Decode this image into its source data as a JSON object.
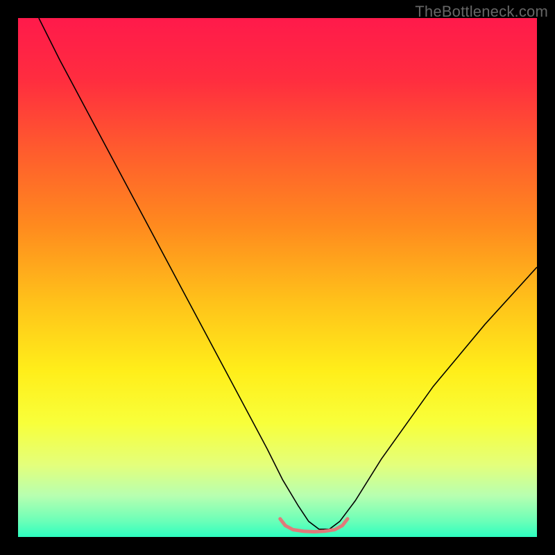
{
  "watermark": "TheBottleneck.com",
  "chart_data": {
    "type": "line",
    "title": "",
    "xlabel": "",
    "ylabel": "",
    "xlim": [
      0,
      100
    ],
    "ylim": [
      0,
      100
    ],
    "background_gradient_stops": [
      {
        "offset": 0.0,
        "color": "#ff1a4b"
      },
      {
        "offset": 0.12,
        "color": "#ff2d3f"
      },
      {
        "offset": 0.25,
        "color": "#ff5a2e"
      },
      {
        "offset": 0.4,
        "color": "#ff8a1e"
      },
      {
        "offset": 0.55,
        "color": "#ffc31a"
      },
      {
        "offset": 0.68,
        "color": "#ffee1a"
      },
      {
        "offset": 0.78,
        "color": "#f8ff3a"
      },
      {
        "offset": 0.86,
        "color": "#e4ff7a"
      },
      {
        "offset": 0.92,
        "color": "#b8ffb0"
      },
      {
        "offset": 0.97,
        "color": "#6affb8"
      },
      {
        "offset": 1.0,
        "color": "#2dffc0"
      }
    ],
    "series": [
      {
        "name": "curve",
        "stroke": "#000000",
        "stroke_width": 1.6,
        "x": [
          4,
          8,
          12,
          16,
          20,
          24,
          28,
          32,
          36,
          40,
          44,
          48,
          51,
          54,
          56,
          58,
          60,
          62,
          65,
          70,
          75,
          80,
          85,
          90,
          95,
          100
        ],
        "y": [
          100,
          92,
          84.5,
          77,
          69.5,
          62,
          54.5,
          47,
          39.5,
          32,
          24.5,
          17,
          11,
          6,
          3,
          1.5,
          1.5,
          3,
          7,
          15,
          22,
          29,
          35,
          41,
          46.5,
          52
        ]
      }
    ],
    "bottom_marker": {
      "stroke": "#e07a7a",
      "stroke_width": 5,
      "x": [
        50.5,
        51.5,
        53,
        55,
        57,
        59,
        61,
        62.5,
        63.5
      ],
      "y": [
        3.5,
        2.2,
        1.4,
        1.1,
        1.0,
        1.1,
        1.4,
        2.2,
        3.5
      ]
    }
  }
}
